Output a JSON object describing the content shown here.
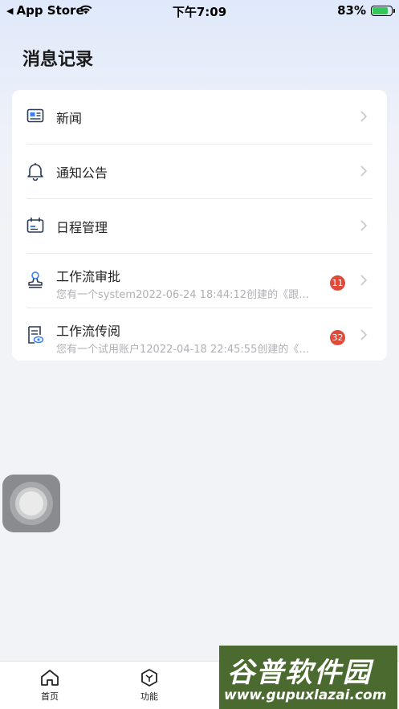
{
  "status_bar": {
    "back_app": "App Store",
    "time": "下午7:09",
    "battery": "83%",
    "battery_level": 0.83
  },
  "page": {
    "title": "消息记录"
  },
  "messages": [
    {
      "title": "新闻",
      "icon": "news-icon"
    },
    {
      "title": "通知公告",
      "icon": "bell-icon"
    },
    {
      "title": "日程管理",
      "icon": "calendar-icon"
    },
    {
      "title": "工作流审批",
      "icon": "stamp-icon",
      "subtitle": "您有一个system2022-06-24 18:44:12创建的《跟…",
      "badge": "11"
    },
    {
      "title": "工作流传阅",
      "icon": "document-view-icon",
      "subtitle": "您有一个试用账户12022-04-18 22:45:55创建的《…",
      "badge": "32"
    }
  ],
  "tabbar": {
    "home": "首页",
    "features": "功能"
  },
  "watermark": {
    "title": "谷普软件园",
    "url": "www.gupuxlazai.com"
  },
  "colors": {
    "badge": "#e04a3a",
    "battery": "#34c759",
    "watermark_bg": "#4a6a2f"
  }
}
